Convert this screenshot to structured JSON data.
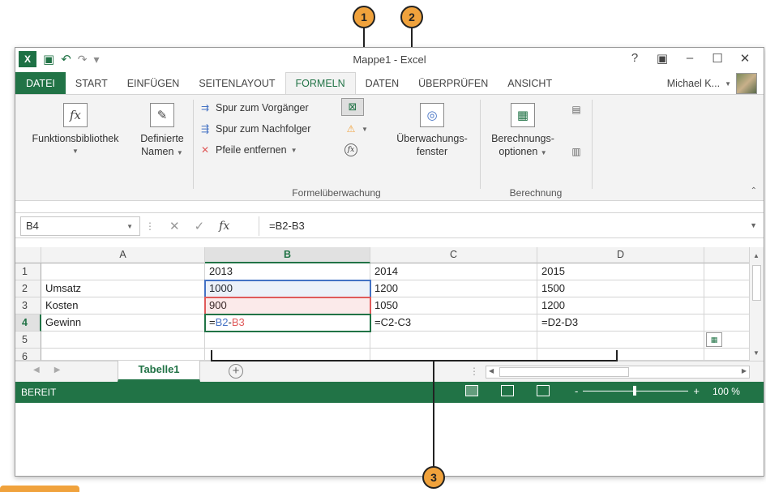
{
  "window": {
    "title": "Mappe1 - Excel",
    "controls": [
      "?",
      "▣",
      "–",
      "☐",
      "✕"
    ]
  },
  "tabs": {
    "file": "DATEI",
    "items": [
      "START",
      "EINFÜGEN",
      "SEITENLAYOUT",
      "FORMELN",
      "DATEN",
      "ÜBERPRÜFEN",
      "ANSICHT"
    ],
    "active": "FORMELN",
    "user": "Michael K..."
  },
  "ribbon": {
    "funktionsbibliothek": "Funktionsbibliothek",
    "definierte_namen_1": "Definierte",
    "definierte_namen_2": "Namen",
    "spur_vorgaenger": "Spur zum Vorgänger",
    "spur_nachfolger": "Spur zum Nachfolger",
    "pfeile_entfernen": "Pfeile entfernen",
    "ueberwachung_1": "Überwachungs-",
    "ueberwachung_2": "fenster",
    "group_formel": "Formelüberwachung",
    "berechnung_1": "Berechnungs-",
    "berechnung_2": "optionen",
    "group_berechnung": "Berechnung"
  },
  "formulabar": {
    "namebox": "B4",
    "fx": "fx",
    "formula": "=B2-B3"
  },
  "grid": {
    "columns": [
      "A",
      "B",
      "C",
      "D"
    ],
    "rows": [
      "1",
      "2",
      "3",
      "4",
      "5",
      "6"
    ],
    "cells": {
      "B1": "2013",
      "C1": "2014",
      "D1": "2015",
      "A2": "Umsatz",
      "B2": "1000",
      "C2": "1200",
      "D2": "1500",
      "A3": "Kosten",
      "B3": "900",
      "C3": "1050",
      "D3": "1200",
      "A4": "Gewinn",
      "B4_eq": "=",
      "B4_ref1": "B2",
      "B4_minus": "-",
      "B4_ref2": "B3",
      "C4": "=C2-C3",
      "D4": "=D2-D3"
    }
  },
  "sheets": {
    "active": "Tabelle1",
    "add": "+"
  },
  "status": {
    "text": "BEREIT",
    "zoom_minus": "-",
    "zoom_plus": "+",
    "zoom": "100 %"
  },
  "callouts": [
    "1",
    "2",
    "3"
  ],
  "colors": {
    "excel_green": "#217346",
    "callout_orange": "#f0a23c",
    "ref_blue": "#4472c4",
    "ref_red": "#e05a5a"
  }
}
